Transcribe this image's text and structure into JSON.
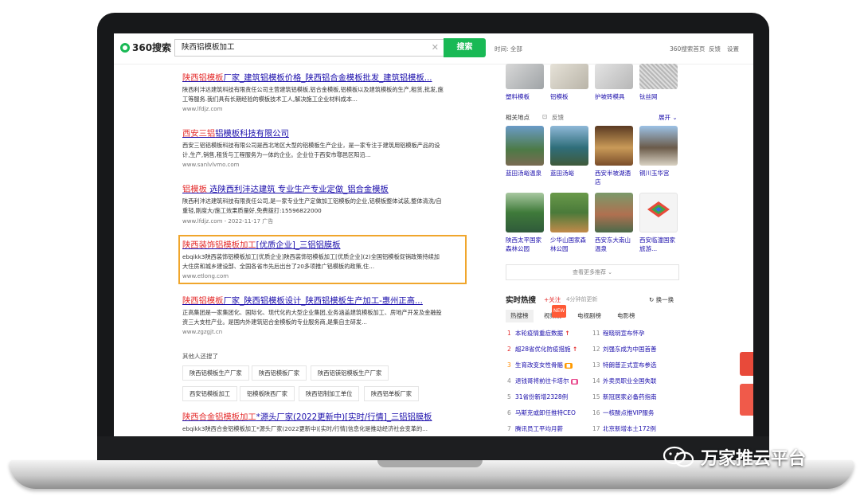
{
  "header": {
    "logo": "360搜索",
    "query": "陕西铝模板加工",
    "search_btn": "搜索",
    "time_filter": "时间: 全部",
    "links": [
      "360搜索首页",
      "反馈",
      "设置"
    ]
  },
  "results": [
    {
      "title_hl": "陕西铝模板",
      "title": "厂家_建筑铝模板价格_陕西铝合金模板批发_建筑铝模板...",
      "desc": "陕西利沣达建筑科技有限责任公司主营建筑铝模板,铝合金模板,铝模板以及建筑模板的生产,租赁,批发,施工等服务.我们具有长期经验的模板技术工人,解决施工企业材料成本...",
      "url": "www.lfdjz.com"
    },
    {
      "title_hl": "西安三铝",
      "title": "铝模板科技有限公司",
      "desc": "西安三铝铝模板科技有限公司是西北地区大型的铝模板生产企业，是一家专注于建筑用铝模板产品的设计,生产,销售,租赁与工程服务为一体的企业。企业位于西安市鄠邑区阳沿...",
      "url": "www.sanlvlvmo.com"
    },
    {
      "title_hl": "铝模板",
      "title": " 选陕西利沣达建筑 专业生产专业定做_铝合金模板",
      "desc": "陕西利沣达建筑科技有限责任公司,是一家专业生产定做加工铝模板的企业,铝模板整体试装,整体清洗/自重轻,刚度大/施工效果质量好,免费拨打:15596822000",
      "url": "www.lfdjz.com - 2022-11-17 广告"
    },
    {
      "title_hl": "陕西装饰铝模板加工",
      "title": "[优质企业]_三铝铝膜板",
      "desc": "ebqikk3陕西装饰铝模板加工[优质企业]陕西装饰铝模板加工[优质企业](2)全国铝模板促销政策持续加大住房和城乡建设部、全国各省市先后出台了20多项推广铝模板的政策,住...",
      "url": "www.etlong.com"
    },
    {
      "title_hl": "陕西铝模板",
      "title": "厂家_陕西铝模板设计_陕西铝模板生产加工-惠州正高...",
      "desc": "正高集团是一家集团化、国际化、现代化的大型企业集团,业务涵盖建筑模板加工、房地产开发及金融投资三大支柱产业。是国内外建筑铝合金模板的专业服务商,是集自主研发...",
      "url": "www.zgzgjt.cn"
    },
    {
      "title_hl": "陕西合金铝模板加工",
      "title": "*源头厂家(2022更新中)[实时/行情]_三铝铝膜板",
      "desc": "ebqikk3陕西合金铝模板加工*源头厂家(2022更新中)[实时/行情]信息化是推动经济社会变革的...",
      "url": ""
    }
  ],
  "also_title": "其他人还搜了",
  "also": [
    "陕西铝模板生产厂家",
    "陕西铝模板厂家",
    "陕西铝镁铝模板生产厂家",
    "西安铝模板加工",
    "铝模板陕西厂家",
    "陕西铝制加工单位",
    "陕西铝单板厂家"
  ],
  "right": {
    "top_items": [
      "塑料模板",
      "铝模板",
      "护坡砖模具",
      "钛丝网"
    ],
    "related_title": "相关地点",
    "feedback": "反馈",
    "expand": "展开",
    "places": [
      "蓝田汤峪温泉",
      "蓝田汤峪",
      "西安半坡湖酒店",
      "铜川玉华宫",
      "陕西太平国家森林公园",
      "少华山国家森林公园",
      "西安东大南山温泉",
      "西安临潼国家旅游..."
    ],
    "more": "查看更多推荐",
    "hot_title": "实时热搜",
    "follow": "+关注",
    "updated": "4分钟前更新",
    "refresh": "换一换",
    "tabs": [
      "热搜榜",
      "视频榜",
      "电视剧榜",
      "电影榜"
    ],
    "hot_left": [
      "本轮疫情重症数据",
      "超28省优化防疫措施",
      "生育改变女性骨骼",
      "退钱哥将前往卡塔尔",
      "31省份新增2328例",
      "马斯克或卸任推特CEO",
      "腾讯员工平均月薪"
    ],
    "hot_right": [
      "程晓玥宣布怀孕",
      "刘强东成为中国首善",
      "特朗普正式宣布参选",
      "外卖员职业全国失联",
      "新冠居家必备药指南",
      "一核酸点推VIP服务",
      "北京新增本土172例"
    ]
  },
  "watermark": "万家推云平台",
  "colors": {
    "accent": "#19b955",
    "link": "#1a0dab",
    "highlight": "#e42d2d",
    "box": "#f0a62c"
  }
}
